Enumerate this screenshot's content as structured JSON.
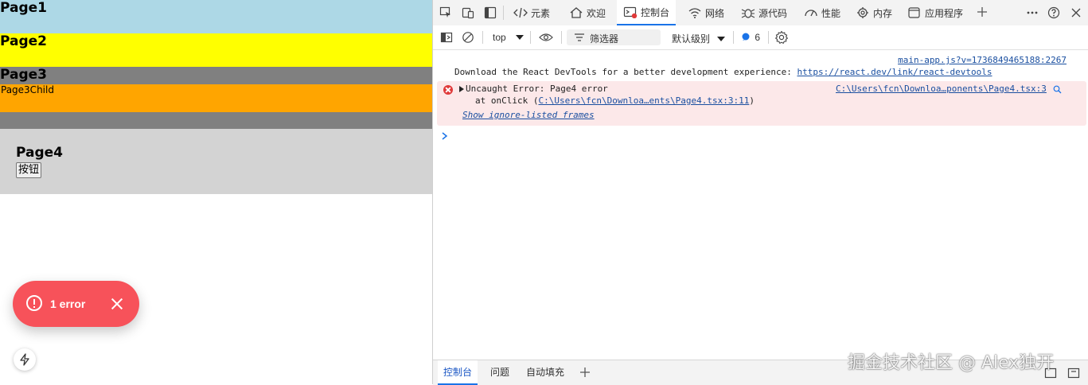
{
  "app": {
    "page1": "Page1",
    "page2": "Page2",
    "page3": "Page3",
    "page3child": "Page3Child",
    "page4": "Page4",
    "page4_button": "按钮",
    "error_toast": "1 error",
    "colors": {
      "page1": "#add8e6",
      "page2": "#ffff00",
      "page3": "#808080",
      "page3child": "#ffa500",
      "page4": "#d3d3d3",
      "toast": "#f7525a"
    }
  },
  "devtools": {
    "tabs": [
      {
        "label": "元素",
        "icon": "code-icon"
      },
      {
        "label": "欢迎",
        "icon": "home-icon"
      },
      {
        "label": "控制台",
        "icon": "console-icon",
        "active": true
      },
      {
        "label": "网络",
        "icon": "wifi-icon"
      },
      {
        "label": "源代码",
        "icon": "bug-icon"
      },
      {
        "label": "性能",
        "icon": "gauge-icon"
      },
      {
        "label": "内存",
        "icon": "chip-icon"
      },
      {
        "label": "应用程序",
        "icon": "app-window-icon"
      }
    ],
    "toolbar": {
      "context": "top",
      "filter_placeholder": "筛选器",
      "level": "默认级别",
      "message_count": "6"
    },
    "console": {
      "devtools_source": "main-app.js?v=1736849465188:2267",
      "devtools_text": "Download the React DevTools for a better development experience: ",
      "devtools_link": "https://react.dev/link/react-devtools",
      "error_title": "Uncaught Error: Page4 error",
      "error_source": "C:\\Users\\fcn\\Downloa…ponents\\Page4.tsx:3",
      "stack_prefix": "at onClick (",
      "stack_link": "C:\\Users\\fcn\\Downloa…ents\\Page4.tsx:3:11",
      "stack_suffix": ")",
      "show_frames": "Show ignore-listed frames"
    },
    "drawer": {
      "tabs": [
        "控制台",
        "问题",
        "自动填充"
      ]
    }
  },
  "watermark": "掘金技术社区 @ Alex独开"
}
